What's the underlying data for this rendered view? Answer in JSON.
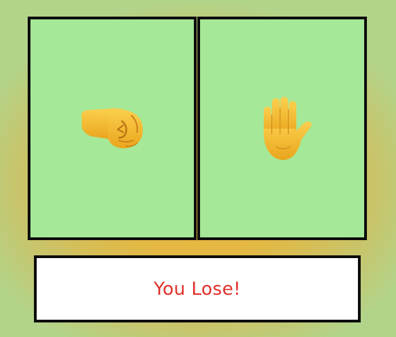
{
  "player": {
    "choice": "rock",
    "icon": "fist-icon"
  },
  "computer": {
    "choice": "paper",
    "icon": "raised-hand-icon"
  },
  "result": {
    "text": "You Lose!"
  },
  "colors": {
    "panel_bg": "#a5e898",
    "border": "#0d0d0d",
    "result_text": "#e1302a",
    "skin": "#f7c33a",
    "background_center": "#eab63c",
    "background_edge": "#b2d48a"
  }
}
